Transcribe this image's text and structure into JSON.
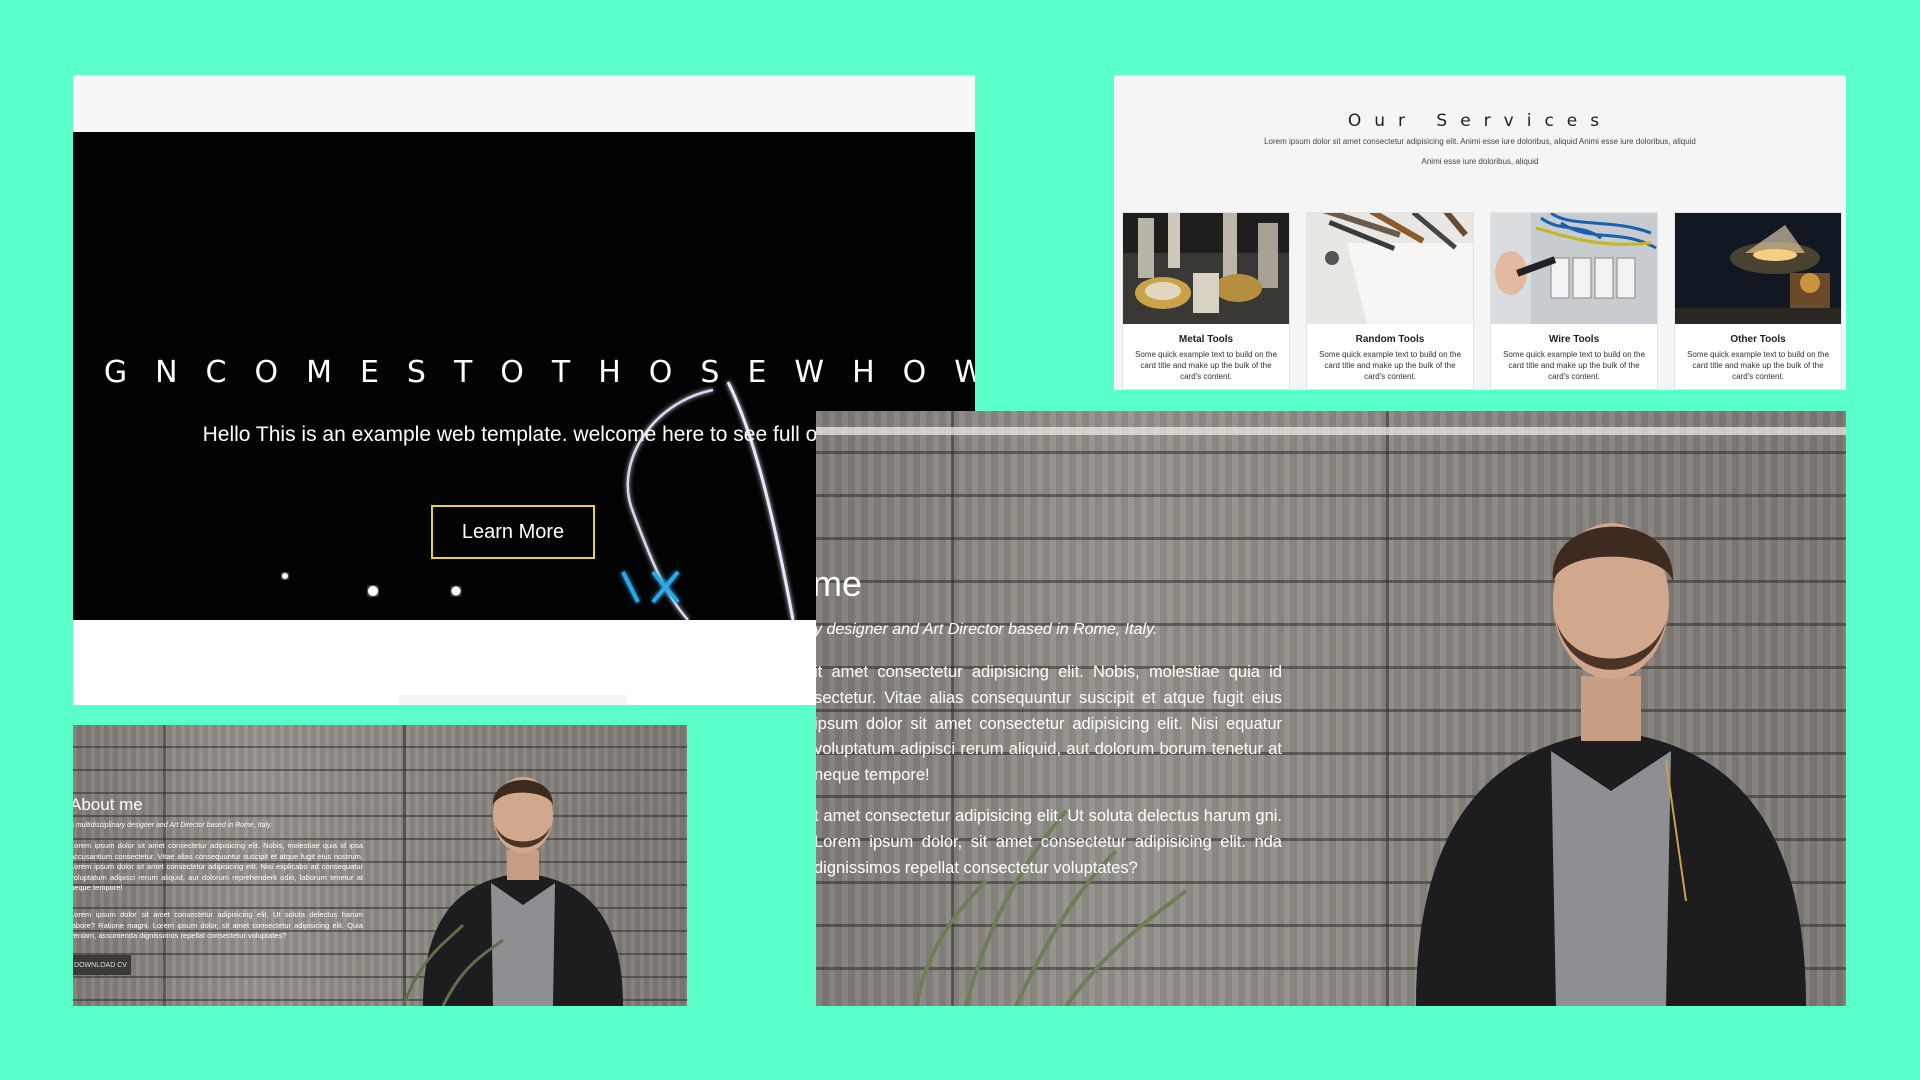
{
  "hero": {
    "marquee": "IGNCOMESTOTHOSEWHOW",
    "subtitle": "Hello This is an example web template. welcome here to see full of it.",
    "button_label": "Learn More",
    "accent": "#e6d43a"
  },
  "services": {
    "title": "Our Services",
    "description_line1": "Lorem ipsum dolor sit amet consectetur adipisicing elit. Animi esse iure doloribus, aliquid Animi esse iure doloribus, aliquid",
    "description_line2": "Animi esse iure doloribus, aliquid",
    "cards": [
      {
        "title": "Metal Tools",
        "text": "Some quick example text to build on the card title and make up the bulk of the card's content.",
        "image": "metal-tools-photo"
      },
      {
        "title": "Random Tools",
        "text": "Some quick example text to build on the card title and make up the bulk of the card's content.",
        "image": "random-tools-photo"
      },
      {
        "title": "Wire Tools",
        "text": "Some quick example text to build on the card title and make up the bulk of the card's content.",
        "image": "wire-tools-photo"
      },
      {
        "title": "Other Tools",
        "text": "Some quick example text to build on the card title and make up the bulk of the card's content.",
        "image": "other-tools-photo"
      }
    ]
  },
  "about_small": {
    "heading": "About me",
    "role": "a multidisciplinary designer and Art Director based in Rome, Italy.",
    "para1": "Lorem ipsum dolor sit amet consectetur adipisicing elit. Nobis, molestiae quia id ipsa accusantium consectetur. Vitae alias consequuntur suscipit et atque fugit eius nostrum. Lorem ipsum dolor sit amet consectetur adipisicing elit. Nisi explicabo ad consequatur voluptatum adipisci rerum aliquid, aut dolorum reprehenderit odio, laborum tenetur at neque tempore!",
    "para2": "Lorem ipsum dolor sit amet consectetur adipisicing elit. Ut soluta delectus harum labore? Ratione magni. Lorem ipsum dolor, sit amet consectetur adipisicing elit. Quia veniam, assumenda dignissimos repellat consectetur voluptates?",
    "cv_button": "DOWNLOAD CV"
  },
  "about_large": {
    "heading": "me",
    "role": "y designer and Art Director based in Rome, Italy.",
    "para1": "it amet consectetur adipisicing elit. Nobis, molestiae quia id sectetur. Vitae alias consequuntur suscipit et atque fugit eius ipsum dolor sit amet consectetur adipisicing elit. Nisi equatur voluptatum adipisci rerum aliquid, aut dolorum borum tenetur at neque tempore!",
    "para2": "t amet consectetur adipisicing elit. Ut soluta delectus harum gni. Lorem ipsum dolor, sit amet consectetur adipisicing elit. nda dignissimos repellat consectetur voluptates?"
  },
  "colors": {
    "background": "#5affc9",
    "hero_dark": "#030303",
    "services_bg": "#f5f5f5",
    "glow_line": "#e8e8ff",
    "glow_cross": "#29a8e8"
  }
}
